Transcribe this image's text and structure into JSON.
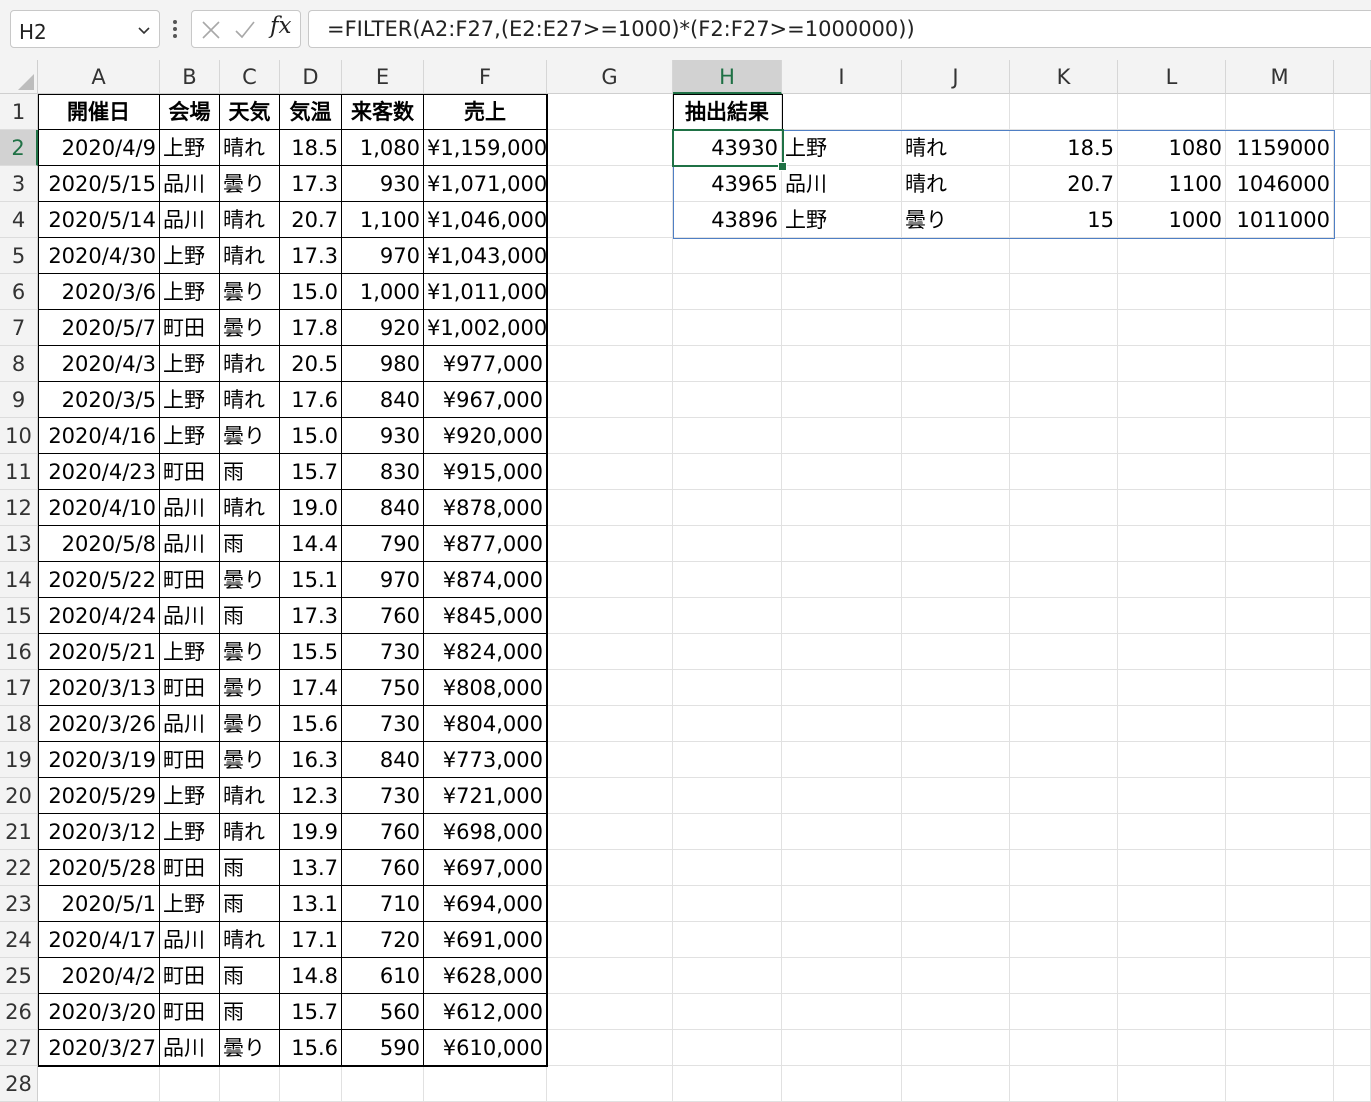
{
  "name_box": "H2",
  "formula": "=FILTER(A2:F27,(E2:E27>=1000)*(F2:F27>=1000000))",
  "icons": {
    "cancel": "close-icon",
    "enter": "check-icon",
    "insert_function": "fx"
  },
  "colors": {
    "selection_green": "#1f7145",
    "spill_border": "#4f7fc4",
    "header_bg": "#f3f3f3"
  },
  "column_headers": [
    "A",
    "B",
    "C",
    "D",
    "E",
    "F",
    "G",
    "H",
    "I",
    "J",
    "K",
    "L",
    "M"
  ],
  "row_headers": [
    "1",
    "2",
    "3",
    "4",
    "5",
    "6",
    "7",
    "8",
    "9",
    "10",
    "11",
    "12",
    "13",
    "14",
    "15",
    "16",
    "17",
    "18",
    "19",
    "20",
    "21",
    "22",
    "23",
    "24",
    "25",
    "26",
    "27",
    "28"
  ],
  "table_headers": [
    "開催日",
    "会場",
    "天気",
    "気温",
    "来客数",
    "売上"
  ],
  "table_rows": [
    [
      "2020/4/9",
      "上野",
      "晴れ",
      "18.5",
      "1,080",
      "¥1,159,000"
    ],
    [
      "2020/5/15",
      "品川",
      "曇り",
      "17.3",
      "930",
      "¥1,071,000"
    ],
    [
      "2020/5/14",
      "品川",
      "晴れ",
      "20.7",
      "1,100",
      "¥1,046,000"
    ],
    [
      "2020/4/30",
      "上野",
      "晴れ",
      "17.3",
      "970",
      "¥1,043,000"
    ],
    [
      "2020/3/6",
      "上野",
      "曇り",
      "15.0",
      "1,000",
      "¥1,011,000"
    ],
    [
      "2020/5/7",
      "町田",
      "曇り",
      "17.8",
      "920",
      "¥1,002,000"
    ],
    [
      "2020/4/3",
      "上野",
      "晴れ",
      "20.5",
      "980",
      "¥977,000"
    ],
    [
      "2020/3/5",
      "上野",
      "晴れ",
      "17.6",
      "840",
      "¥967,000"
    ],
    [
      "2020/4/16",
      "上野",
      "曇り",
      "15.0",
      "930",
      "¥920,000"
    ],
    [
      "2020/4/23",
      "町田",
      "雨",
      "15.7",
      "830",
      "¥915,000"
    ],
    [
      "2020/4/10",
      "品川",
      "晴れ",
      "19.0",
      "840",
      "¥878,000"
    ],
    [
      "2020/5/8",
      "品川",
      "雨",
      "14.4",
      "790",
      "¥877,000"
    ],
    [
      "2020/5/22",
      "町田",
      "曇り",
      "15.1",
      "970",
      "¥874,000"
    ],
    [
      "2020/4/24",
      "品川",
      "雨",
      "17.3",
      "760",
      "¥845,000"
    ],
    [
      "2020/5/21",
      "上野",
      "曇り",
      "15.5",
      "730",
      "¥824,000"
    ],
    [
      "2020/3/13",
      "町田",
      "曇り",
      "17.4",
      "750",
      "¥808,000"
    ],
    [
      "2020/3/26",
      "品川",
      "曇り",
      "15.6",
      "730",
      "¥804,000"
    ],
    [
      "2020/3/19",
      "町田",
      "曇り",
      "16.3",
      "840",
      "¥773,000"
    ],
    [
      "2020/5/29",
      "上野",
      "晴れ",
      "12.3",
      "730",
      "¥721,000"
    ],
    [
      "2020/3/12",
      "上野",
      "晴れ",
      "19.9",
      "760",
      "¥698,000"
    ],
    [
      "2020/5/28",
      "町田",
      "雨",
      "13.7",
      "760",
      "¥697,000"
    ],
    [
      "2020/5/1",
      "上野",
      "雨",
      "13.1",
      "710",
      "¥694,000"
    ],
    [
      "2020/4/17",
      "品川",
      "晴れ",
      "17.1",
      "720",
      "¥691,000"
    ],
    [
      "2020/4/2",
      "町田",
      "雨",
      "14.8",
      "610",
      "¥628,000"
    ],
    [
      "2020/3/20",
      "町田",
      "雨",
      "15.7",
      "560",
      "¥612,000"
    ],
    [
      "2020/3/27",
      "品川",
      "曇り",
      "15.6",
      "590",
      "¥610,000"
    ]
  ],
  "result_title": "抽出結果",
  "result_rows": [
    [
      "43930",
      "上野",
      "晴れ",
      "18.5",
      "1080",
      "1159000"
    ],
    [
      "43965",
      "品川",
      "晴れ",
      "20.7",
      "1100",
      "1046000"
    ],
    [
      "43896",
      "上野",
      "曇り",
      "15",
      "1000",
      "1011000"
    ]
  ]
}
